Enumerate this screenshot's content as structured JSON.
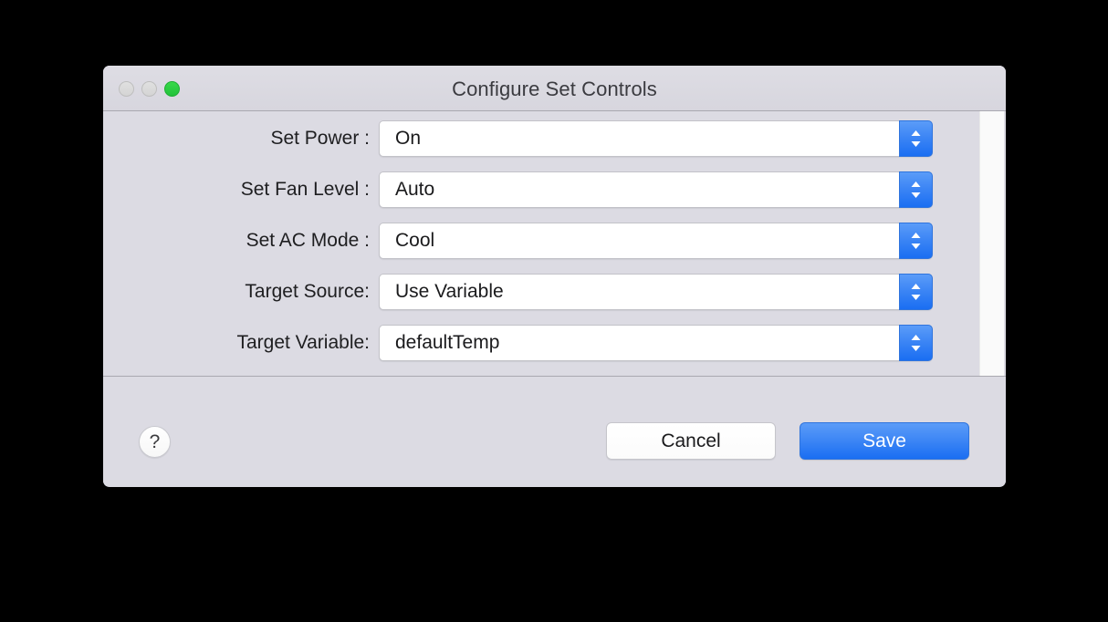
{
  "window": {
    "title": "Configure Set Controls",
    "traffic_lights": [
      {
        "name": "close",
        "state": "disabled",
        "color": "#dcdcdc"
      },
      {
        "name": "minimize",
        "state": "disabled",
        "color": "#dcdcdc"
      },
      {
        "name": "zoom",
        "state": "enabled",
        "color": "#28cd41"
      }
    ],
    "background": "#dcdbe3"
  },
  "form": {
    "rows": [
      {
        "label": "Set Power :",
        "value": "On",
        "control": "popup-button"
      },
      {
        "label": "Set Fan Level :",
        "value": "Auto",
        "control": "popup-button"
      },
      {
        "label": "Set AC Mode :",
        "value": "Cool",
        "control": "popup-button"
      },
      {
        "label": "Target Source:",
        "value": "Use Variable",
        "control": "popup-button"
      },
      {
        "label": "Target Variable:",
        "value": "defaultTemp",
        "control": "popup-button"
      }
    ],
    "scrollbar_visible": true
  },
  "footer": {
    "help_label": "?",
    "cancel_label": "Cancel",
    "save_label": "Save",
    "default_button": "Save",
    "accent_color": "#3d86f5"
  }
}
